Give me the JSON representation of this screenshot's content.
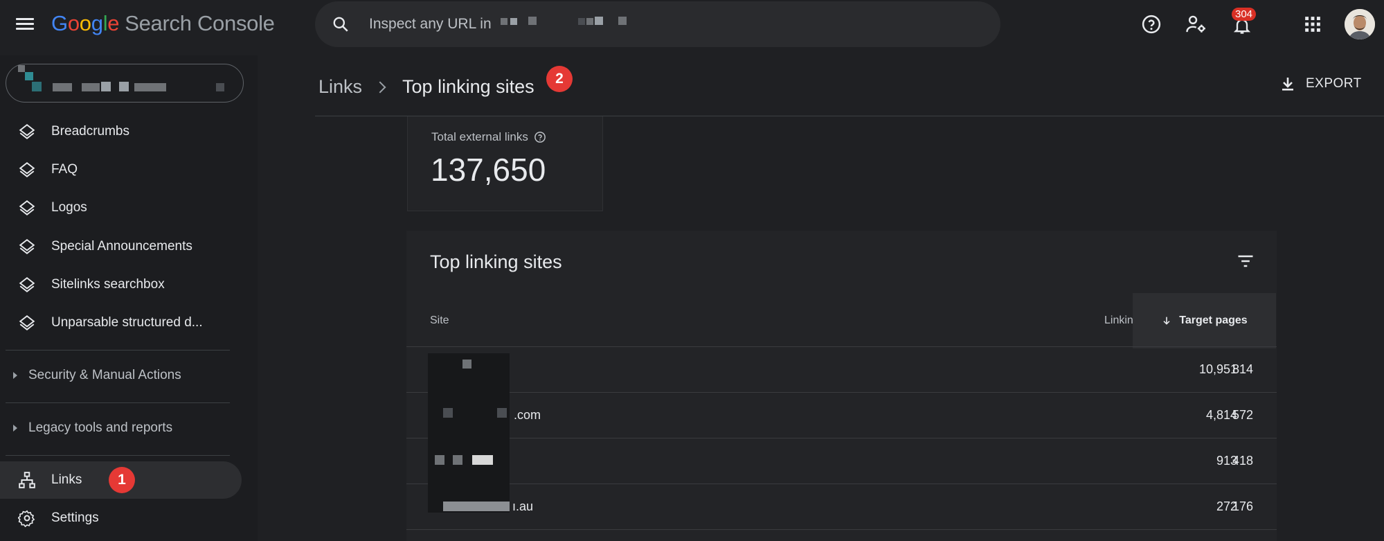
{
  "topbar": {
    "logo": {
      "g1": "G",
      "g2": "o",
      "g3": "o",
      "g4": "g",
      "g5": "l",
      "g6": "e",
      "product": "Search Console"
    },
    "search_placeholder": "Inspect any URL in",
    "notifications_count": "304",
    "icons": [
      "menu-icon",
      "search-icon",
      "help-icon",
      "manage-users-icon",
      "notifications-icon",
      "apps-icon",
      "avatar"
    ]
  },
  "sidebar": {
    "items": [
      {
        "label": "Breadcrumbs",
        "icon": "layers-icon"
      },
      {
        "label": "FAQ",
        "icon": "layers-icon"
      },
      {
        "label": "Logos",
        "icon": "layers-icon"
      },
      {
        "label": "Special Announcements",
        "icon": "layers-icon"
      },
      {
        "label": "Sitelinks searchbox",
        "icon": "layers-icon"
      },
      {
        "label": "Unparsable structured d...",
        "icon": "layers-icon"
      }
    ],
    "sections": [
      {
        "label": "Security & Manual Actions"
      },
      {
        "label": "Legacy tools and reports"
      }
    ],
    "bottom": [
      {
        "label": "Links",
        "icon": "sitemap-icon",
        "active": true,
        "step": "1"
      },
      {
        "label": "Settings",
        "icon": "gear-icon"
      }
    ]
  },
  "header": {
    "breadcrumb_root": "Links",
    "breadcrumb_current": "Top linking sites",
    "step": "2",
    "export_label": "EXPORT"
  },
  "summary": {
    "label": "Total external links",
    "value": "137,650"
  },
  "table": {
    "title": "Top linking sites",
    "columns": {
      "site": "Site",
      "linking": "Linking pages",
      "target": "Target pages"
    },
    "sorted_column": "Target pages",
    "rows": [
      {
        "site": "",
        "linking": "10,951",
        "target": "814"
      },
      {
        "site": ".com",
        "linking": "4,814",
        "target": "572"
      },
      {
        "site": "",
        "linking": "913",
        "target": "418"
      },
      {
        "site": "ı.au",
        "linking": "272",
        "target": "176"
      }
    ]
  },
  "colors": {
    "accent_red": "#e53935",
    "badge_red": "#d93025",
    "background": "#1f2023"
  }
}
